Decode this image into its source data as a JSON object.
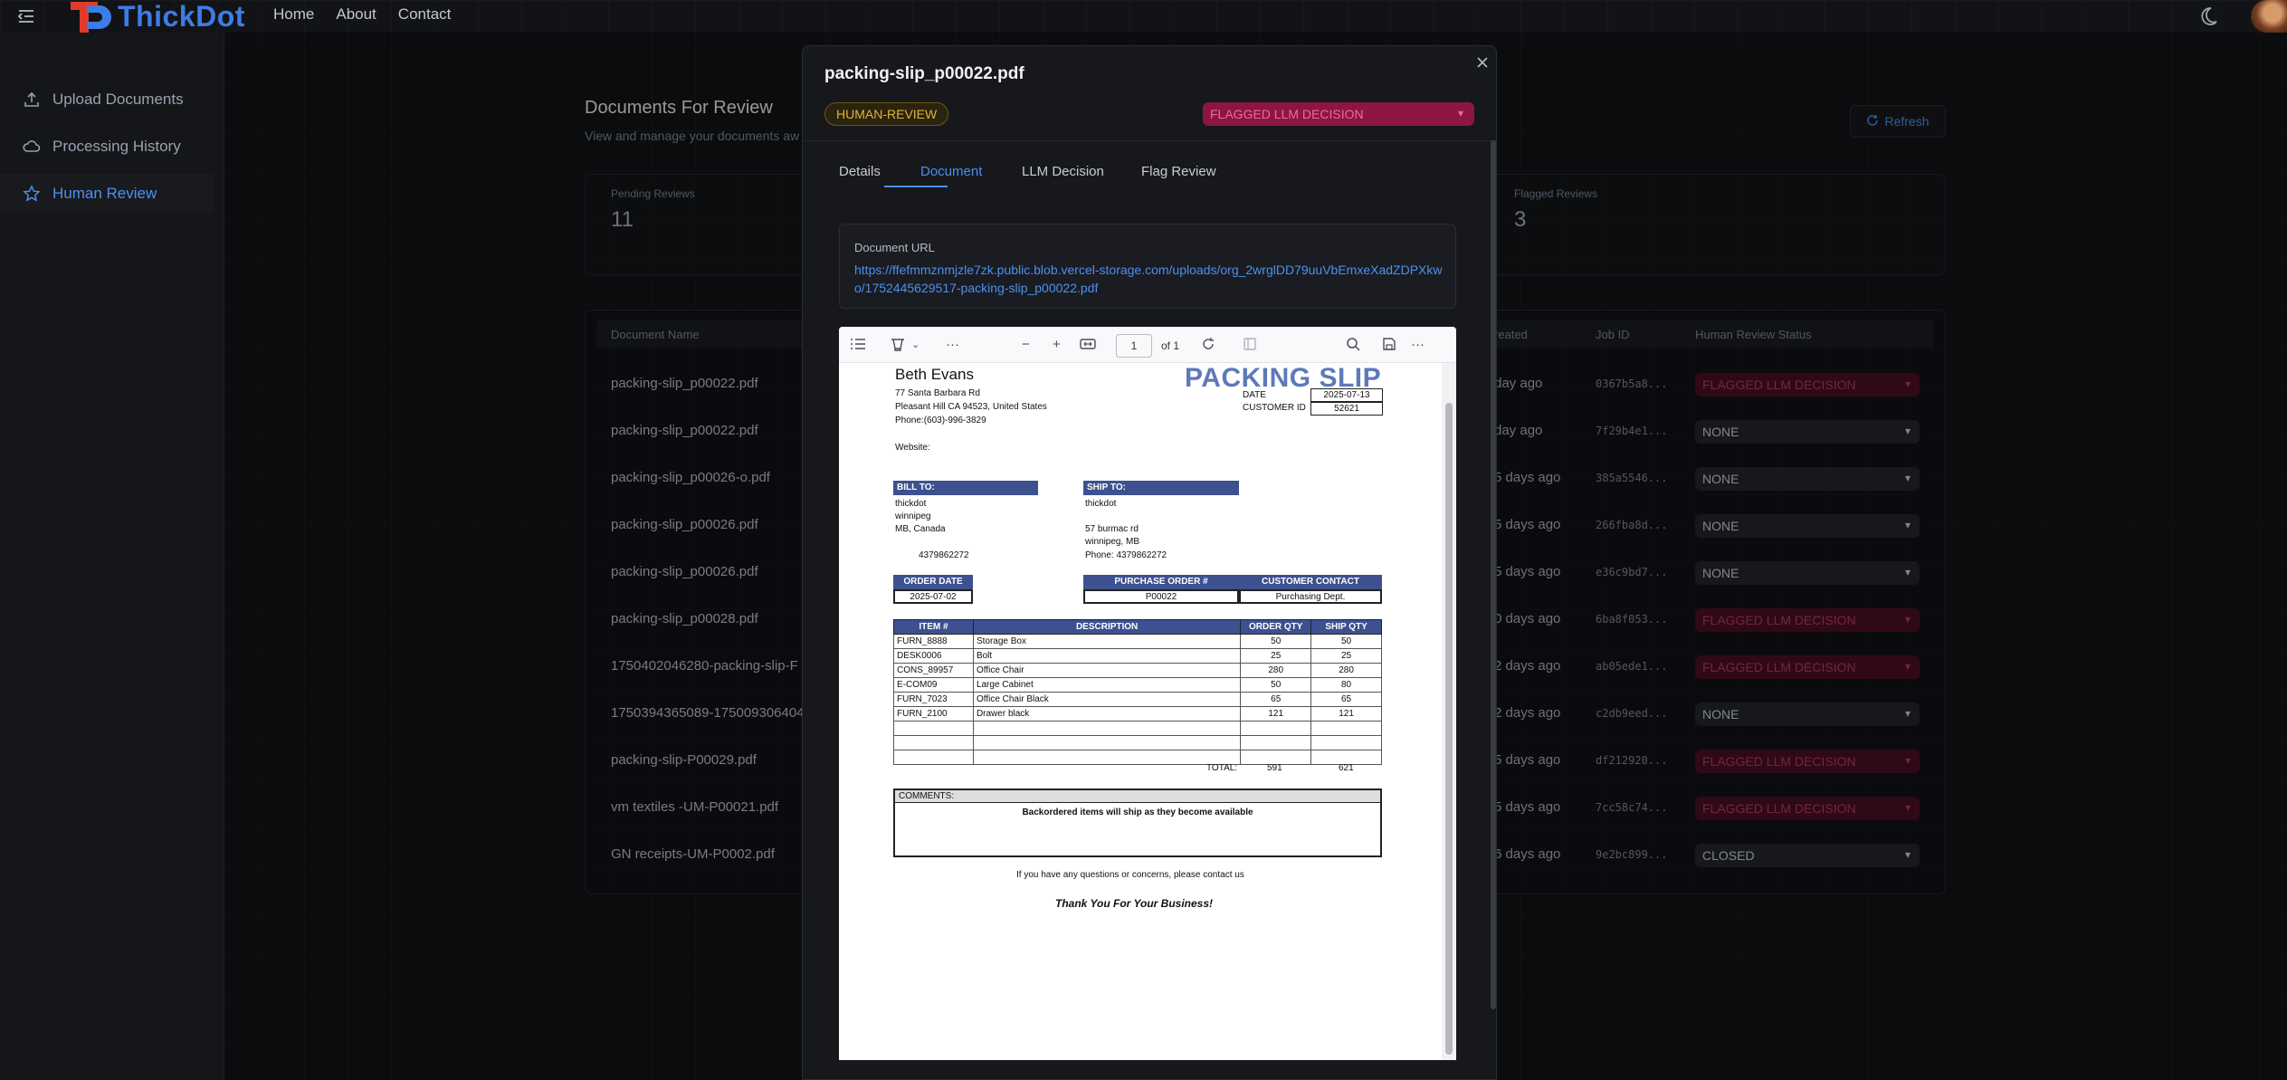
{
  "topbar": {
    "brand": "ThickDot",
    "nav": [
      "Home",
      "About",
      "Contact"
    ]
  },
  "sidebar": {
    "items": [
      {
        "label": "Upload Documents",
        "icon": "upload-icon"
      },
      {
        "label": "Processing History",
        "icon": "cloud-icon"
      },
      {
        "label": "Human Review",
        "icon": "star-icon",
        "active": true
      }
    ]
  },
  "page": {
    "title": "Documents For Review",
    "subtitle": "View and manage your documents aw",
    "refresh_label": "Refresh",
    "stats": [
      {
        "label": "Pending Reviews",
        "value": "11"
      },
      {
        "label": "Flagged Reviews",
        "value": "3"
      }
    ],
    "table": {
      "headers": [
        "Document Name",
        "reated",
        "Job ID",
        "Human Review Status"
      ],
      "rows": [
        {
          "name": "packing-slip_p00022.pdf",
          "created": "day ago",
          "job": "0367b5a8...",
          "status": "FLAGGED LLM DECISION",
          "flag": true
        },
        {
          "name": "packing-slip_p00022.pdf",
          "created": "day ago",
          "job": "7f29b4e1...",
          "status": "NONE",
          "flag": false
        },
        {
          "name": "packing-slip_p00026-o.pdf",
          "created": "5 days ago",
          "job": "385a5546...",
          "status": "NONE",
          "flag": false
        },
        {
          "name": "packing-slip_p00026.pdf",
          "created": "5 days ago",
          "job": "266fba8d...",
          "status": "NONE",
          "flag": false
        },
        {
          "name": "packing-slip_p00026.pdf",
          "created": "5 days ago",
          "job": "e36c9bd7...",
          "status": "NONE",
          "flag": false
        },
        {
          "name": "packing-slip_p00028.pdf",
          "created": "0 days ago",
          "job": "6ba8f053...",
          "status": "FLAGGED LLM DECISION",
          "flag": true
        },
        {
          "name": "1750402046280-packing-slip-F",
          "created": "2 days ago",
          "job": "ab05ede1...",
          "status": "FLAGGED LLM DECISION",
          "flag": true
        },
        {
          "name": "1750394365089-175009306404",
          "created": "2 days ago",
          "job": "c2db9eed...",
          "status": "NONE",
          "flag": false
        },
        {
          "name": "packing-slip-P00029.pdf",
          "created": "5 days ago",
          "job": "df212920...",
          "status": "FLAGGED LLM DECISION",
          "flag": true
        },
        {
          "name": "vm textiles -UM-P00021.pdf",
          "created": "5 days ago",
          "job": "7cc58c74...",
          "status": "FLAGGED LLM DECISION",
          "flag": true
        },
        {
          "name": "GN receipts-UM-P0002.pdf",
          "created": "6 days ago",
          "job": "9e2bc899...",
          "status": "CLOSED",
          "flag": false
        }
      ]
    }
  },
  "modal": {
    "title": "packing-slip_p00022.pdf",
    "badge": "HUMAN-REVIEW",
    "decision": "FLAGGED LLM DECISION",
    "tabs": [
      "Details",
      "Document",
      "LLM Decision",
      "Flag Review"
    ],
    "active_tab": "Document",
    "url_label": "Document URL",
    "url": "https://ffefmmznmjzle7zk.public.blob.vercel-storage.com/uploads/org_2wrglDD79uuVbEmxeXadZDPXkwo/1752445629517-packing-slip_p00022.pdf",
    "viewer": {
      "page": "1",
      "of": "of 1"
    }
  },
  "slip": {
    "title": "PACKING SLIP",
    "company": "Beth Evans",
    "address": [
      "77 Santa Barbara Rd",
      "Pleasant Hill CA 94523, United States",
      "Phone:(603)-996-3829",
      "Website:"
    ],
    "date_label": "DATE",
    "date": "2025-07-13",
    "customer_id_label": "CUSTOMER ID",
    "customer_id": "52621",
    "bill_to_label": "BILL TO:",
    "bill_to": [
      "thickdot",
      "winnipeg",
      "MB, Canada",
      "4379862272"
    ],
    "ship_to_label": "SHIP TO:",
    "ship_to": [
      "thickdot",
      "57 burmac rd",
      "winnipeg, MB",
      "Phone: 4379862272"
    ],
    "order_date_label": "ORDER DATE",
    "order_date": "2025-07-02",
    "po_label": "PURCHASE ORDER #",
    "po": "P00022",
    "contact_label": "CUSTOMER CONTACT",
    "contact": "Purchasing Dept.",
    "items_headers": [
      "ITEM #",
      "DESCRIPTION",
      "ORDER QTY",
      "SHIP QTY"
    ],
    "items": [
      [
        "FURN_8888",
        "Storage Box",
        "50",
        "50"
      ],
      [
        "DESK0006",
        "Bolt",
        "25",
        "25"
      ],
      [
        "CONS_89957",
        "Office Chair",
        "280",
        "280"
      ],
      [
        "E-COM09",
        "Large Cabinet",
        "50",
        "80"
      ],
      [
        "FURN_7023",
        "Office Chair Black",
        "65",
        "65"
      ],
      [
        "FURN_2100",
        "Drawer black",
        "121",
        "121"
      ],
      [
        "",
        "",
        "",
        ""
      ],
      [
        "",
        "",
        "",
        ""
      ],
      [
        "",
        "",
        "",
        ""
      ]
    ],
    "total_label": "TOTAL:",
    "total_order": "591",
    "total_ship": "621",
    "comments_label": "COMMENTS:",
    "comments": "Backordered items will ship as they become available",
    "contact_note": "If you have any questions or concerns, please contact us",
    "thanks": "Thank You For Your Business!"
  }
}
